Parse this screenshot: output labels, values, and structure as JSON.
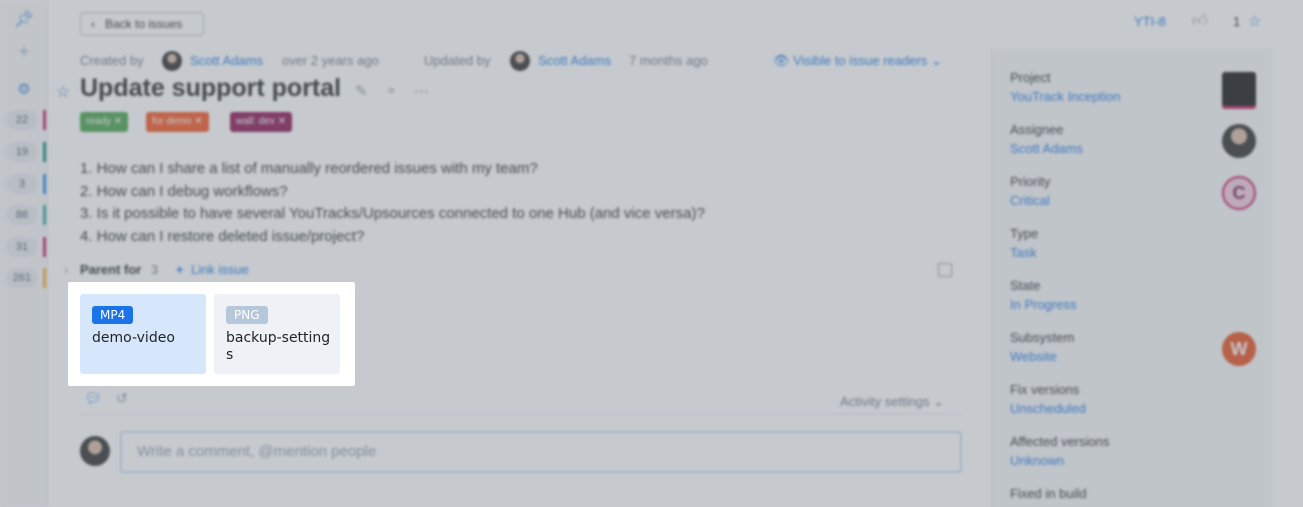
{
  "rail": {
    "icons": [
      "pin-icon",
      "add-icon",
      "settings-icon"
    ],
    "counts": [
      "22",
      "19",
      "3",
      "86",
      "31",
      "261"
    ],
    "count_colors": [
      "#c2185b",
      "#00897b",
      "#1e88e5",
      "#26a69a",
      "#c2185b",
      "#f9a825"
    ]
  },
  "header": {
    "back_label": "Back to issues",
    "issue_id": "YTI-8",
    "votes": "1"
  },
  "meta": {
    "created_by_label": "Created by",
    "created_by": "Scott Adams",
    "created_ago": "over 2 years ago",
    "updated_by_label": "Updated by",
    "updated_by": "Scott Adams",
    "updated_ago": "7 months ago",
    "visibility": "Visible to issue readers"
  },
  "issue": {
    "title": "Update support portal",
    "tags": [
      {
        "label": "ready",
        "color": "#43a047"
      },
      {
        "label": "for demo",
        "color": "#f4511e"
      },
      {
        "label": "wall: dev",
        "color": "#880e4f"
      }
    ],
    "description": [
      "1. How can I share a list of manually reordered issues with my team?",
      "2. How can I debug workflows?",
      "3. Is it possible to have several YouTracks/Upsources connected to one Hub (and vice versa)?",
      "4. How can I restore deleted issue/project?"
    ]
  },
  "links": {
    "parent_for_label": "Parent for",
    "parent_for_count": "3",
    "link_issue_label": "Link issue"
  },
  "attachments": [
    {
      "type": "MP4",
      "name": "demo-video",
      "badge_color": "#1a73e8",
      "bg": "#d6e6fb"
    },
    {
      "type": "PNG",
      "name": "backup-settings",
      "badge_color": "#b7c7da",
      "bg": "#eef1f5"
    }
  ],
  "activity": {
    "settings_label": "Activity settings",
    "comment_placeholder": "Write a comment, @mention people"
  },
  "fields": [
    {
      "label": "Project",
      "value": "YouTrack Inception",
      "avatar": "project"
    },
    {
      "label": "Assignee",
      "value": "Scott Adams",
      "avatar": "person"
    },
    {
      "label": "Priority",
      "value": "Critical",
      "avatar": "C"
    },
    {
      "label": "Type",
      "value": "Task",
      "avatar": ""
    },
    {
      "label": "State",
      "value": "In Progress",
      "avatar": ""
    },
    {
      "label": "Subsystem",
      "value": "Website",
      "avatar": "W"
    },
    {
      "label": "Fix versions",
      "value": "Unscheduled",
      "avatar": ""
    },
    {
      "label": "Affected versions",
      "value": "Unknown",
      "avatar": ""
    },
    {
      "label": "Fixed in build",
      "value": "",
      "avatar": ""
    }
  ]
}
